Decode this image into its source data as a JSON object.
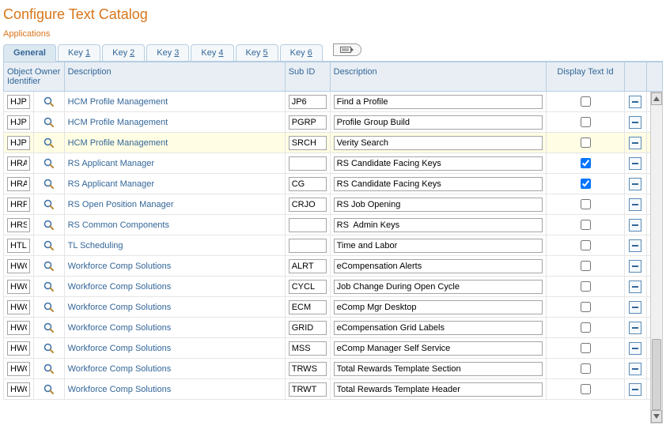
{
  "page_title": "Configure Text Catalog",
  "section_label": "Applications",
  "tabs": [
    {
      "label": "General",
      "active": true
    },
    {
      "label_prefix": "Key ",
      "underline": "1"
    },
    {
      "label_prefix": "Key ",
      "underline": "2"
    },
    {
      "label_prefix": "Key ",
      "underline": "3"
    },
    {
      "label_prefix": "Key ",
      "underline": "4"
    },
    {
      "label_prefix": "Key ",
      "underline": "5"
    },
    {
      "label_prefix": "Key ",
      "underline": "6"
    }
  ],
  "columns": {
    "owner": "Object Owner Identifier",
    "desc1": "Description",
    "subid": "Sub ID",
    "desc2": "Description",
    "display": "Display Text Id"
  },
  "rows": [
    {
      "owner": "HJPM",
      "desc1": "HCM Profile Management",
      "subid": "JP6",
      "desc2": "Find a Profile",
      "display": false,
      "highlight": false
    },
    {
      "owner": "HJPM",
      "desc1": "HCM Profile Management",
      "subid": "PGRP",
      "desc2": "Profile Group Build",
      "display": false,
      "highlight": false
    },
    {
      "owner": "HJPM",
      "desc1": "HCM Profile Management",
      "subid": "SRCH",
      "desc2": "Verity Search",
      "display": false,
      "highlight": true
    },
    {
      "owner": "HRAM",
      "desc1": "RS Applicant Manager",
      "subid": "",
      "desc2": "RS Candidate Facing Keys",
      "display": true,
      "highlight": false
    },
    {
      "owner": "HRAM",
      "desc1": "RS Applicant Manager",
      "subid": "CG",
      "desc2": "RS Candidate Facing Keys",
      "display": true,
      "highlight": false
    },
    {
      "owner": "HRPM",
      "desc1": "RS Open Position Manager",
      "subid": "CRJO",
      "desc2": "RS Job Opening",
      "display": false,
      "highlight": false
    },
    {
      "owner": "HRS",
      "desc1": "RS Common Components",
      "subid": "",
      "desc2": "RS  Admin Keys",
      "display": false,
      "highlight": false
    },
    {
      "owner": "HTLS",
      "desc1": "TL Scheduling",
      "subid": "",
      "desc2": "Time and Labor",
      "display": false,
      "highlight": false
    },
    {
      "owner": "HWCS",
      "desc1": "Workforce Comp Solutions",
      "subid": "ALRT",
      "desc2": "eCompensation Alerts",
      "display": false,
      "highlight": false
    },
    {
      "owner": "HWCS",
      "desc1": "Workforce Comp Solutions",
      "subid": "CYCL",
      "desc2": "Job Change During Open Cycle",
      "display": false,
      "highlight": false
    },
    {
      "owner": "HWCS",
      "desc1": "Workforce Comp Solutions",
      "subid": "ECM",
      "desc2": "eComp Mgr Desktop",
      "display": false,
      "highlight": false
    },
    {
      "owner": "HWCS",
      "desc1": "Workforce Comp Solutions",
      "subid": "GRID",
      "desc2": "eCompensation Grid Labels",
      "display": false,
      "highlight": false
    },
    {
      "owner": "HWCS",
      "desc1": "Workforce Comp Solutions",
      "subid": "MSS",
      "desc2": "eComp Manager Self Service",
      "display": false,
      "highlight": false
    },
    {
      "owner": "HWCS",
      "desc1": "Workforce Comp Solutions",
      "subid": "TRWS",
      "desc2": "Total Rewards Template Section",
      "display": false,
      "highlight": false
    },
    {
      "owner": "HWCS",
      "desc1": "Workforce Comp Solutions",
      "subid": "TRWT",
      "desc2": "Total Rewards Template Header",
      "display": false,
      "highlight": false
    }
  ]
}
